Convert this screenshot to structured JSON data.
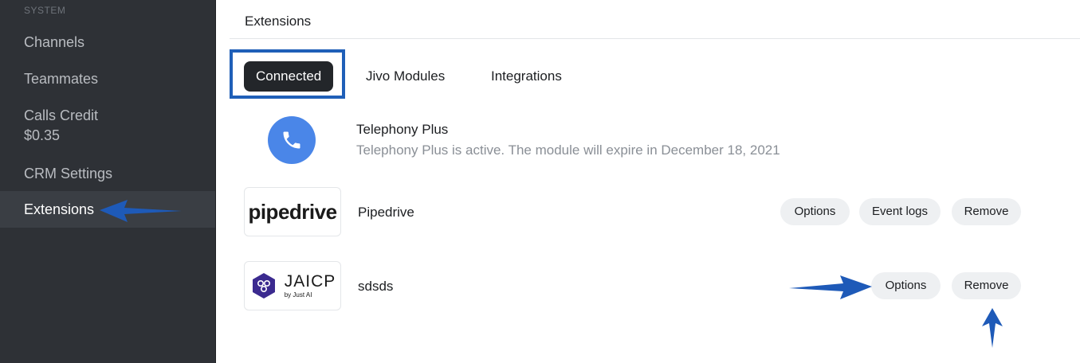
{
  "sidebar": {
    "section_label": "SYSTEM",
    "items": [
      {
        "label": "Channels"
      },
      {
        "label": "Teammates"
      },
      {
        "label": "Calls Credit",
        "sub": "$0.35"
      },
      {
        "label": "CRM Settings"
      },
      {
        "label": "Extensions",
        "active": true
      }
    ]
  },
  "page": {
    "title": "Extensions"
  },
  "tabs": [
    {
      "label": "Connected",
      "active": true
    },
    {
      "label": "Jivo Modules"
    },
    {
      "label": "Integrations"
    }
  ],
  "extensions": [
    {
      "name": "Telephony Plus",
      "status": "Telephony Plus is active. The module will expire in December 18, 2021",
      "icon": "phone-icon"
    },
    {
      "name": "Pipedrive",
      "logo_text": "pipedrive",
      "buttons": [
        "Options",
        "Event logs",
        "Remove"
      ]
    },
    {
      "name": "sdsds",
      "logo_text": "JAICP",
      "logo_subtext": "by Just AI",
      "buttons": [
        "Options",
        "Remove"
      ]
    }
  ],
  "colors": {
    "sidebar_bg": "#2e3136",
    "active_tab_bg": "#23262a",
    "highlight_blue": "#1f5fb8",
    "telephony_blue": "#4a86e8",
    "button_bg": "#eef0f2"
  }
}
